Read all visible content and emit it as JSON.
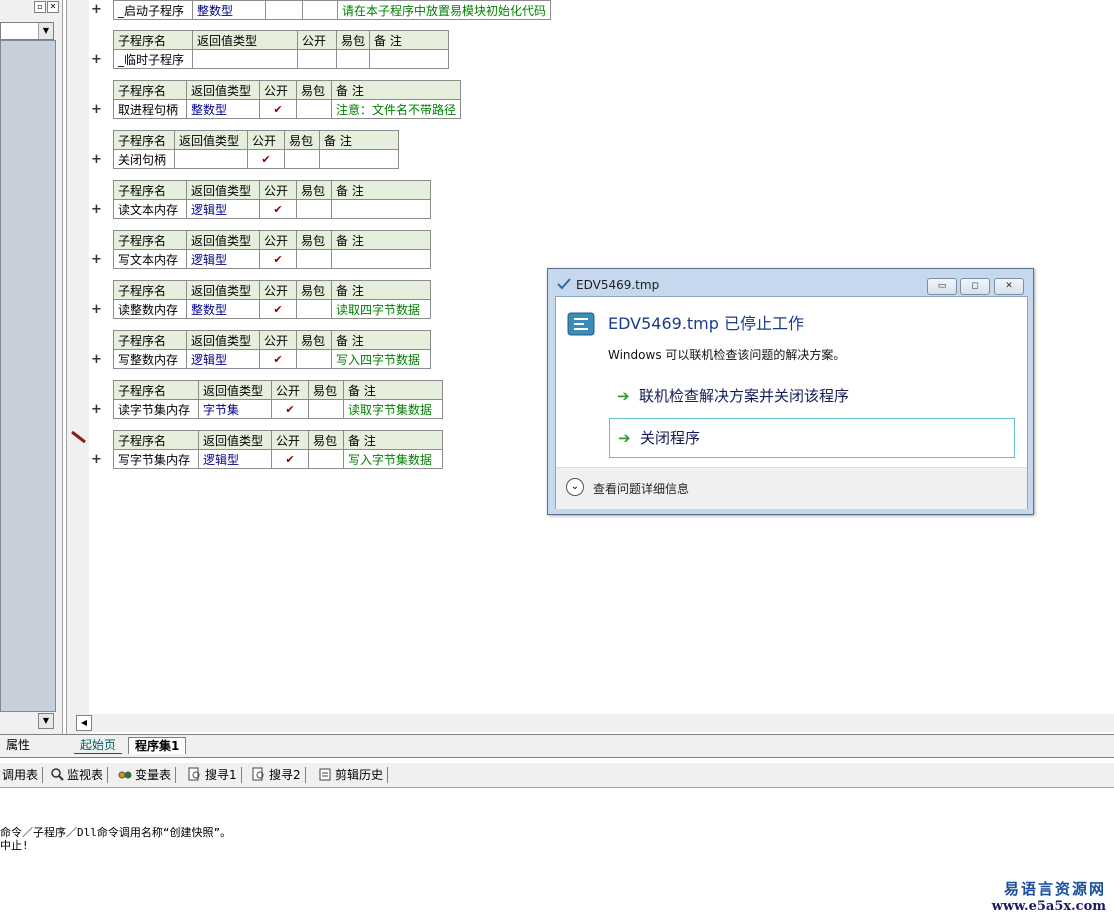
{
  "subroutine_header": {
    "name": "子程序名",
    "return_type": "返回值类型",
    "public": "公开",
    "easy_pkg": "易包",
    "note": "备 注"
  },
  "top_row": {
    "name": "_启动子程序",
    "type": "整数型",
    "note": "请在本子程序中放置易模块初始化代码"
  },
  "subroutines": [
    {
      "name": "_临时子程序",
      "type": "",
      "public": "",
      "note": ""
    },
    {
      "name": "取进程句柄",
      "type": "整数型",
      "public": "✔",
      "note": "注意：文件名不带路径"
    },
    {
      "name": "关闭句柄",
      "type": "",
      "public": "✔",
      "note": ""
    },
    {
      "name": "读文本内存",
      "type": "逻辑型",
      "public": "✔",
      "note": ""
    },
    {
      "name": "写文本内存",
      "type": "逻辑型",
      "public": "✔",
      "note": ""
    },
    {
      "name": "读整数内存",
      "type": "整数型",
      "public": "✔",
      "note": "读取四字节数据"
    },
    {
      "name": "写整数内存",
      "type": "逻辑型",
      "public": "✔",
      "note": "写入四字节数据"
    },
    {
      "name": "读字节集内存",
      "type": "字节集",
      "public": "✔",
      "note": "读取字节集数据"
    },
    {
      "name": "写字节集内存",
      "type": "逻辑型",
      "public": "✔",
      "note": "写入字节集数据"
    }
  ],
  "plus_glyph": "+",
  "left_panel": {
    "mini_buttons": [
      "▫",
      "✕"
    ]
  },
  "tabs": {
    "props": "属性",
    "home": "起始页",
    "set": "程序集1"
  },
  "tool_tabs": [
    {
      "label": "调用表",
      "icon": ""
    },
    {
      "label": "监视表",
      "icon": "magnifier-icon"
    },
    {
      "label": "变量表",
      "icon": "glasses-icon"
    },
    {
      "label": "搜寻1",
      "icon": "search-doc-icon"
    },
    {
      "label": "搜寻2",
      "icon": "search-doc-icon"
    },
    {
      "label": "剪辑历史",
      "icon": "clipboard-icon"
    }
  ],
  "output": {
    "line1": "命令／子程序／Dll命令调用名称“创建快照”。",
    "line2": "中止!"
  },
  "watermark": {
    "cn": "易语言资源网",
    "url": "www.e5a5x.com"
  },
  "dialog": {
    "title": "EDV5469.tmp",
    "heading": "EDV5469.tmp 已停止工作",
    "message": "Windows 可以联机检查该问题的解决方案。",
    "option1": "联机检查解决方案并关闭该程序",
    "option2": "关闭程序",
    "details": "查看问题详细信息",
    "caption_buttons": {
      "minimize": "▭",
      "maximize": "◻",
      "close": "✕"
    }
  },
  "colors": {
    "header_bg": "#e6eedc",
    "type_text": "#00008b",
    "note_text": "#008000",
    "dialog_frame": "#c5d8ee"
  }
}
